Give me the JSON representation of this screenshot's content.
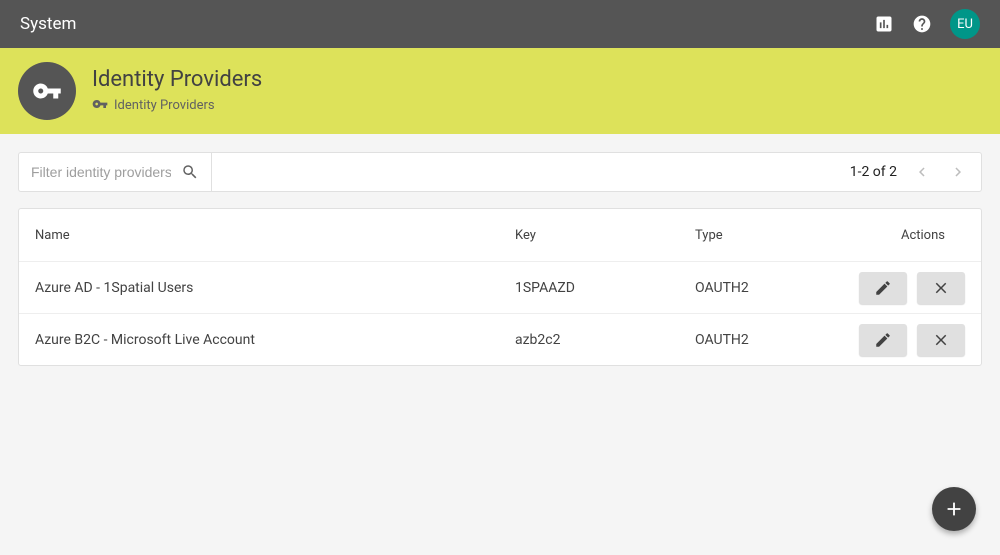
{
  "topbar": {
    "title": "System",
    "avatar_initials": "EU"
  },
  "banner": {
    "title": "Identity Providers",
    "breadcrumb_label": "Identity Providers"
  },
  "toolbar": {
    "filter_placeholder": "Filter identity providers...",
    "pagination_text": "1-2 of 2"
  },
  "table": {
    "headers": {
      "name": "Name",
      "key": "Key",
      "type": "Type",
      "actions": "Actions"
    },
    "rows": [
      {
        "name": "Azure AD - 1Spatial Users",
        "key": "1SPAAZD",
        "type": "OAUTH2"
      },
      {
        "name": "Azure B2C - Microsoft Live Account",
        "key": "azb2c2",
        "type": "OAUTH2"
      }
    ]
  }
}
